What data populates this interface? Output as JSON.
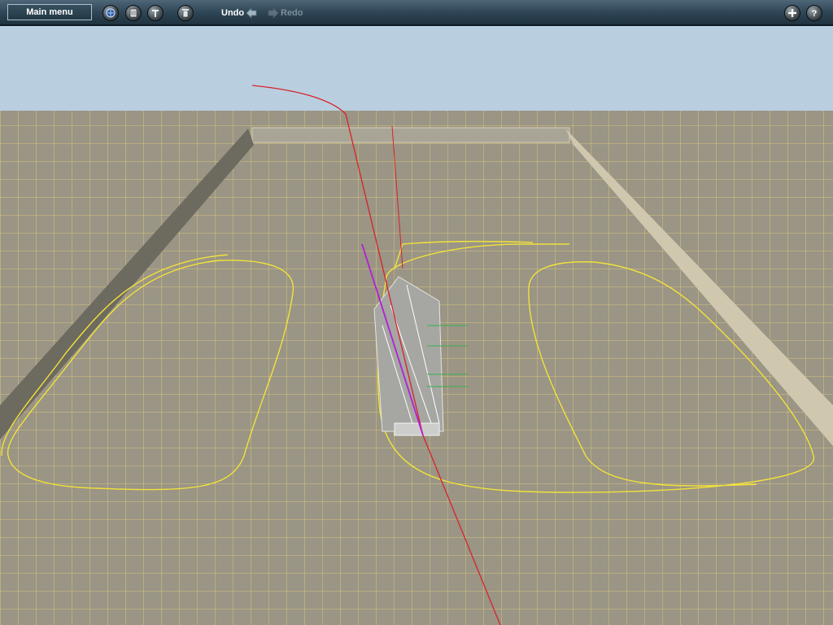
{
  "toolbar": {
    "main_menu_label": "Main menu",
    "undo_label": "Undo",
    "redo_label": "Redo",
    "icons": [
      "globe-icon",
      "layers-icon",
      "tool-icon",
      "trash-icon",
      "undo-arrow-icon",
      "redo-arrow-icon",
      "add-icon",
      "help-icon"
    ]
  },
  "scene": {
    "sky_color": "#b9cfe0",
    "ground_color": "#9a9585",
    "grid_color": "#d9c57a",
    "track_color": "#f2e23a",
    "spline_red": "#d8222a",
    "spline_magenta": "#b21fd6"
  }
}
